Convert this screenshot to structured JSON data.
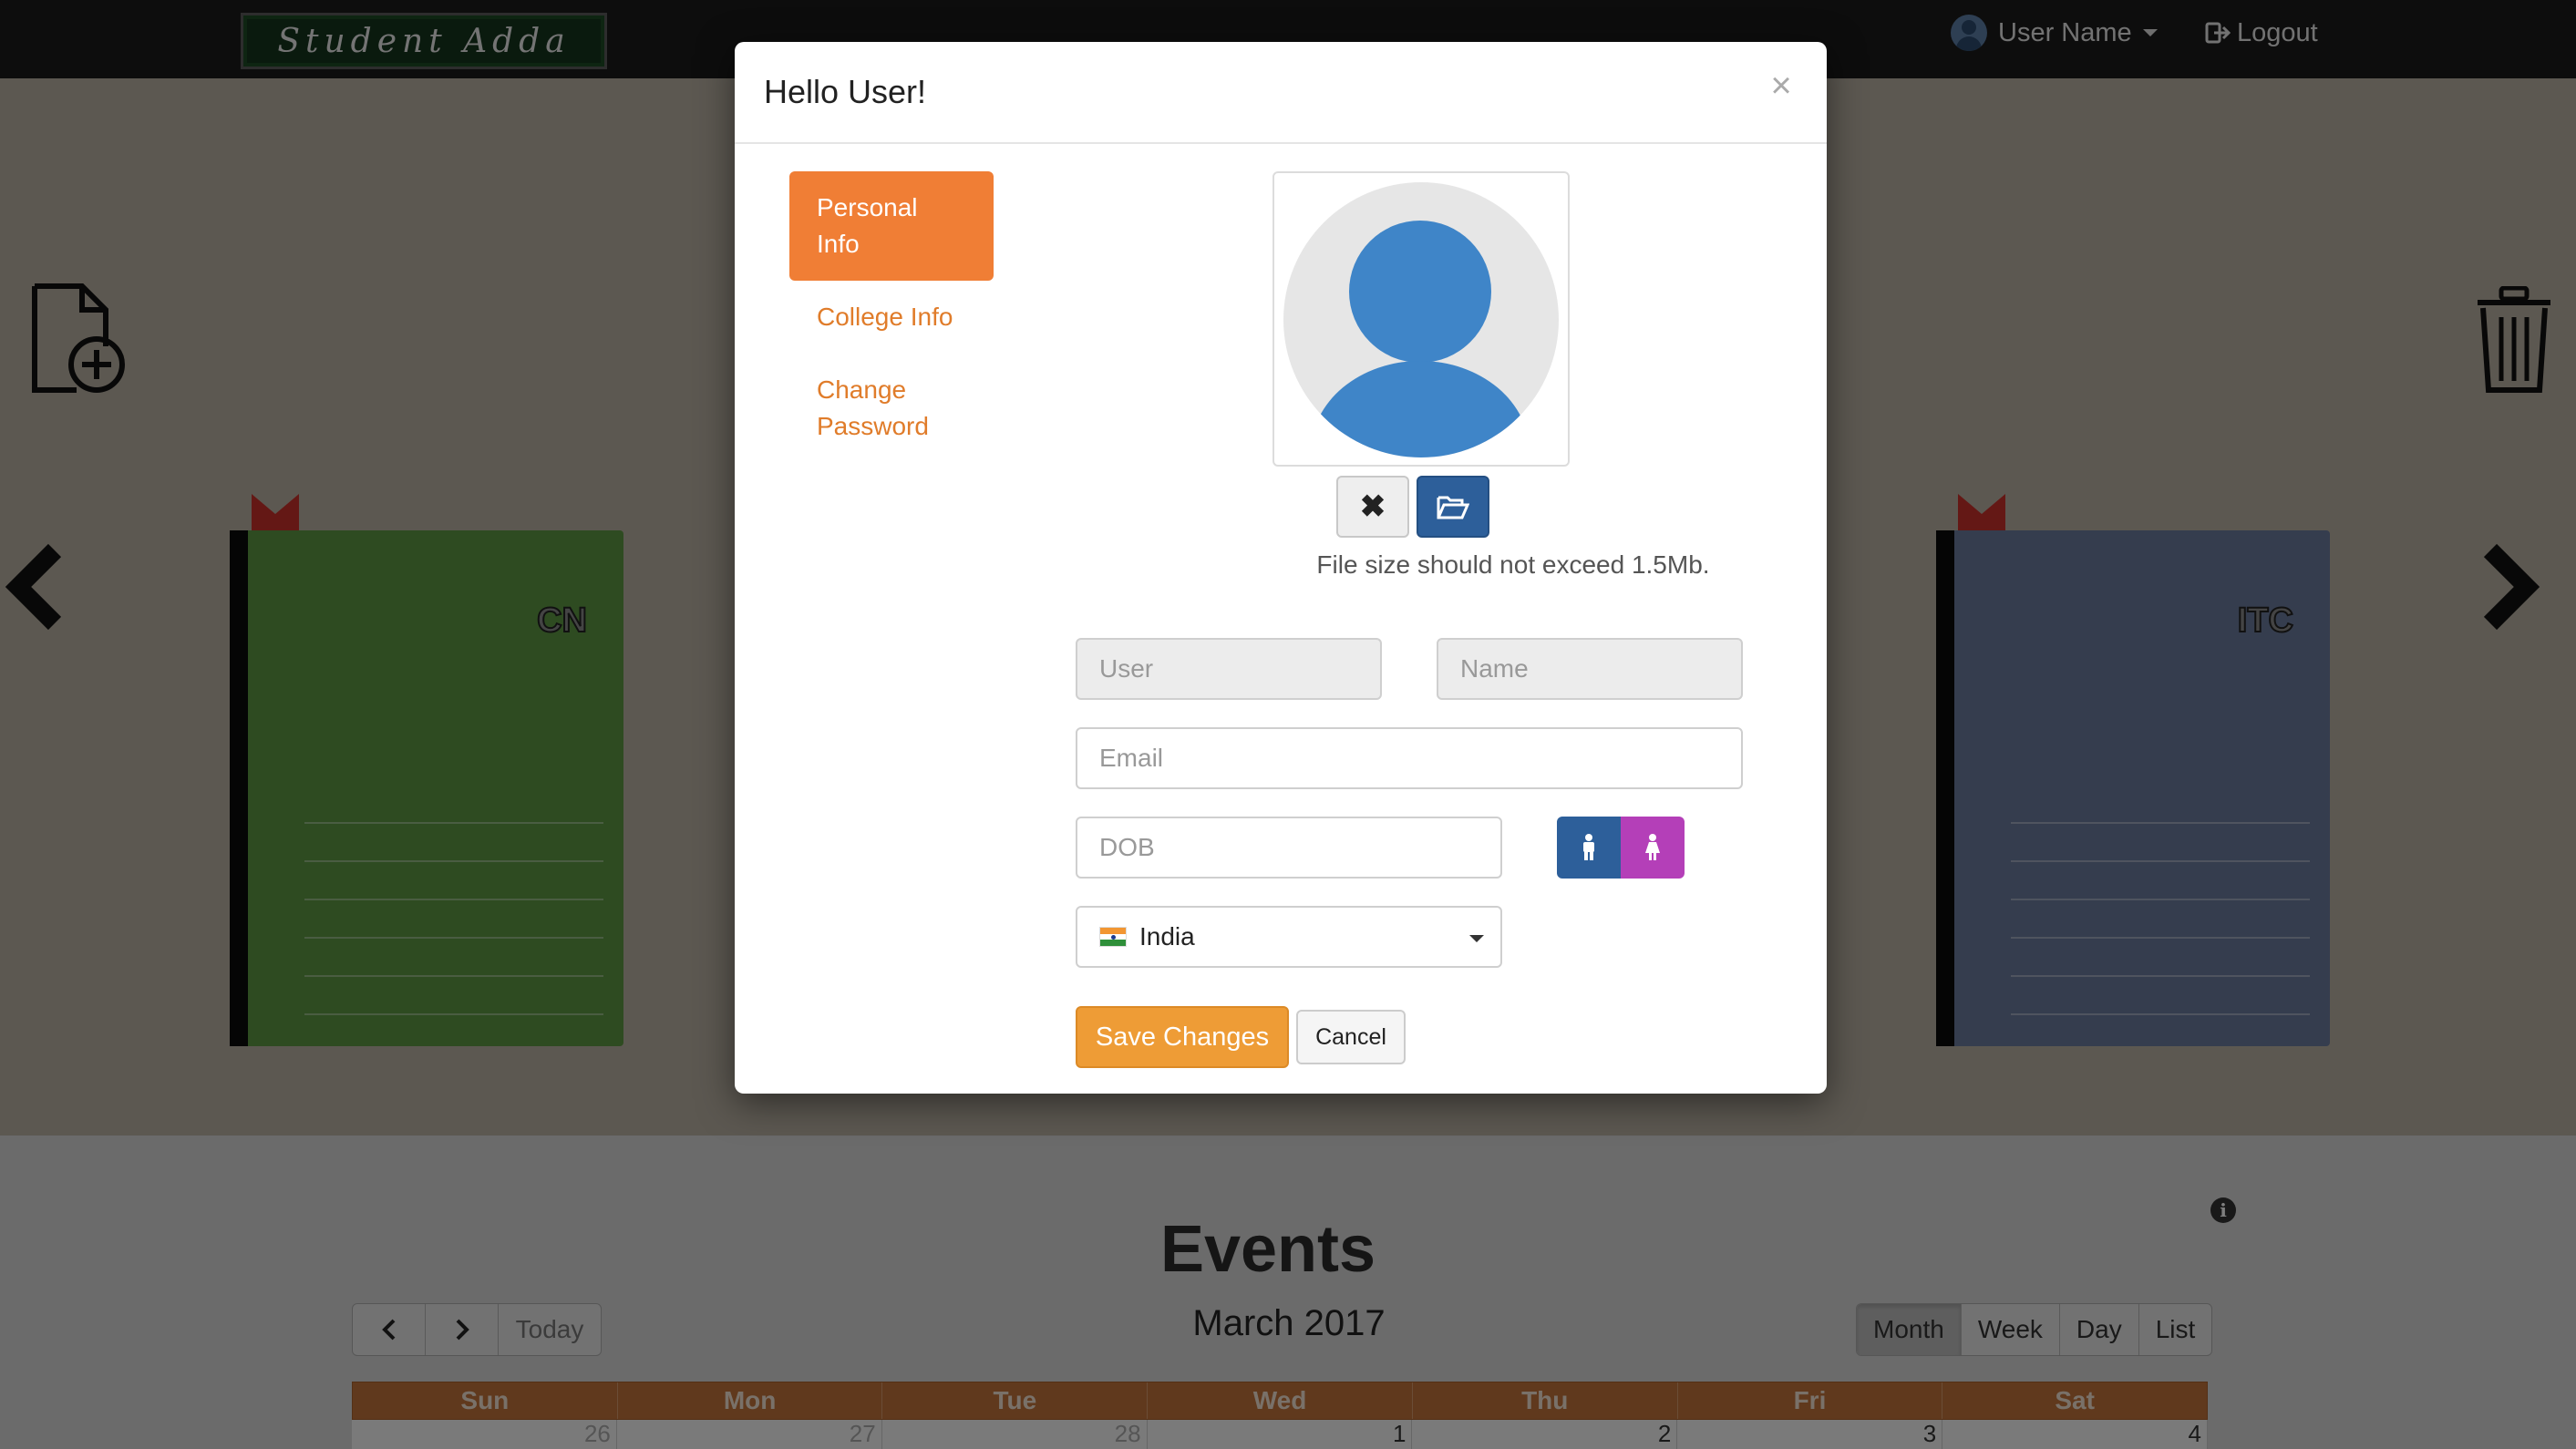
{
  "navbar": {
    "brand": "Student Adda",
    "user_name": "User Name",
    "logout_label": "Logout"
  },
  "books": [
    {
      "title": "CN",
      "color": "#5c9743"
    },
    {
      "title": "ITC",
      "color": "#6a7b9c"
    }
  ],
  "modal": {
    "title": "Hello User!",
    "close_label": "×",
    "tabs": [
      {
        "label": "Personal Info",
        "active": true
      },
      {
        "label": "College Info",
        "active": false
      },
      {
        "label": "Change Password",
        "active": false
      }
    ],
    "avatar": {
      "remove_icon": "✖",
      "browse_icon": "folder-open-icon",
      "file_note": "File size should not exceed 1.5Mb."
    },
    "form": {
      "user_placeholder": "User",
      "name_placeholder": "Name",
      "email_placeholder": "Email",
      "dob_placeholder": "DOB",
      "gender_options": [
        "male",
        "female"
      ],
      "country_selected": "India",
      "save_label": "Save Changes",
      "cancel_label": "Cancel"
    }
  },
  "events": {
    "title": "Events",
    "calendar_title": "March 2017",
    "today_label": "Today",
    "views": [
      "Month",
      "Week",
      "Day",
      "List"
    ],
    "active_view": "Month",
    "weekdays": [
      "Sun",
      "Mon",
      "Tue",
      "Wed",
      "Thu",
      "Fri",
      "Sat"
    ],
    "first_week": [
      "26",
      "27",
      "28",
      "1",
      "2",
      "3",
      "4"
    ]
  },
  "colors": {
    "accent_orange": "#f07e35",
    "save_button": "#ee9c36",
    "primary_blue": "#2d5f9a",
    "female_purple": "#b43fb8",
    "calendar_header": "#c1733a"
  }
}
